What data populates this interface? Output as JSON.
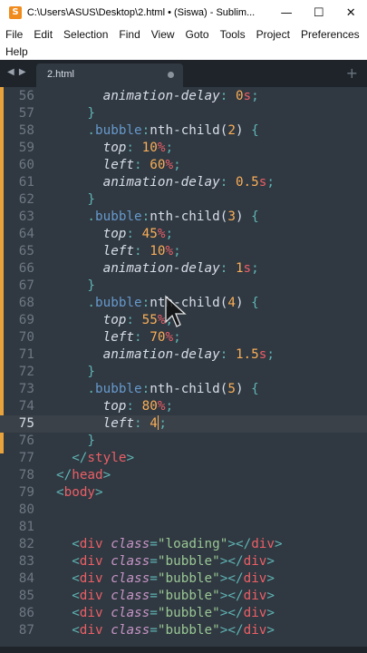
{
  "window": {
    "title": "C:\\Users\\ASUS\\Desktop\\2.html • (Siswa) - Sublim...",
    "minimize_glyph": "—",
    "maximize_glyph": "☐",
    "close_glyph": "✕"
  },
  "menu": [
    "File",
    "Edit",
    "Selection",
    "Find",
    "View",
    "Goto",
    "Tools",
    "Project",
    "Preferences",
    "Help"
  ],
  "tab": {
    "label": "2.html",
    "new_tab_glyph": "+"
  },
  "colors": {
    "background": "#303841",
    "keyword": "#c695c6",
    "selector": "#6699cc",
    "property": "#d8dee9",
    "number": "#f9ae58",
    "unit": "#ec5f66",
    "tag": "#ec5f66",
    "attribute": "#c695c6",
    "string": "#99c794",
    "punctuation": "#5fb4b4",
    "line_number": "#6d7883",
    "modified_bar": "#e8a33d"
  },
  "code_lines": [
    {
      "n": "56",
      "i": 3,
      "t": [
        [
          "p",
          "animation-delay"
        ],
        [
          "pn",
          ":"
        ],
        [
          "x",
          " "
        ],
        [
          "num",
          "0"
        ],
        [
          "u",
          "s"
        ],
        [
          "pn",
          ";"
        ]
      ]
    },
    {
      "n": "57",
      "i": 2,
      "t": [
        [
          "pn",
          "}"
        ]
      ]
    },
    {
      "n": "58",
      "i": 2,
      "t": [
        [
          "pn",
          "."
        ],
        [
          "sel",
          "bubble"
        ],
        [
          "pn",
          ":"
        ],
        [
          "x",
          "nth-child("
        ],
        [
          "num",
          "2"
        ],
        [
          "x",
          ") "
        ],
        [
          "pn",
          "{"
        ]
      ]
    },
    {
      "n": "59",
      "i": 3,
      "t": [
        [
          "p",
          "top"
        ],
        [
          "pn",
          ":"
        ],
        [
          "x",
          " "
        ],
        [
          "num",
          "10"
        ],
        [
          "u",
          "%"
        ],
        [
          "pn",
          ";"
        ]
      ]
    },
    {
      "n": "60",
      "i": 3,
      "t": [
        [
          "p",
          "left"
        ],
        [
          "pn",
          ":"
        ],
        [
          "x",
          " "
        ],
        [
          "num",
          "60"
        ],
        [
          "u",
          "%"
        ],
        [
          "pn",
          ";"
        ]
      ]
    },
    {
      "n": "61",
      "i": 3,
      "t": [
        [
          "p",
          "animation-delay"
        ],
        [
          "pn",
          ":"
        ],
        [
          "x",
          " "
        ],
        [
          "num",
          "0.5"
        ],
        [
          "u",
          "s"
        ],
        [
          "pn",
          ";"
        ]
      ]
    },
    {
      "n": "62",
      "i": 2,
      "t": [
        [
          "pn",
          "}"
        ]
      ]
    },
    {
      "n": "63",
      "i": 2,
      "t": [
        [
          "pn",
          "."
        ],
        [
          "sel",
          "bubble"
        ],
        [
          "pn",
          ":"
        ],
        [
          "x",
          "nth-child("
        ],
        [
          "num",
          "3"
        ],
        [
          "x",
          ") "
        ],
        [
          "pn",
          "{"
        ]
      ]
    },
    {
      "n": "64",
      "i": 3,
      "t": [
        [
          "p",
          "top"
        ],
        [
          "pn",
          ":"
        ],
        [
          "x",
          " "
        ],
        [
          "num",
          "45"
        ],
        [
          "u",
          "%"
        ],
        [
          "pn",
          ";"
        ]
      ]
    },
    {
      "n": "65",
      "i": 3,
      "t": [
        [
          "p",
          "left"
        ],
        [
          "pn",
          ":"
        ],
        [
          "x",
          " "
        ],
        [
          "num",
          "10"
        ],
        [
          "u",
          "%"
        ],
        [
          "pn",
          ";"
        ]
      ]
    },
    {
      "n": "66",
      "i": 3,
      "t": [
        [
          "p",
          "animation-delay"
        ],
        [
          "pn",
          ":"
        ],
        [
          "x",
          " "
        ],
        [
          "num",
          "1"
        ],
        [
          "u",
          "s"
        ],
        [
          "pn",
          ";"
        ]
      ]
    },
    {
      "n": "67",
      "i": 2,
      "t": [
        [
          "pn",
          "}"
        ]
      ]
    },
    {
      "n": "68",
      "i": 2,
      "t": [
        [
          "pn",
          "."
        ],
        [
          "sel",
          "bubble"
        ],
        [
          "pn",
          ":"
        ],
        [
          "x",
          "nth-child("
        ],
        [
          "num",
          "4"
        ],
        [
          "x",
          ") "
        ],
        [
          "pn",
          "{"
        ]
      ]
    },
    {
      "n": "69",
      "i": 3,
      "t": [
        [
          "p",
          "top"
        ],
        [
          "pn",
          ":"
        ],
        [
          "x",
          " "
        ],
        [
          "num",
          "55"
        ],
        [
          "u",
          "%"
        ],
        [
          "pn",
          ";"
        ]
      ]
    },
    {
      "n": "70",
      "i": 3,
      "t": [
        [
          "p",
          "left"
        ],
        [
          "pn",
          ":"
        ],
        [
          "x",
          " "
        ],
        [
          "num",
          "70"
        ],
        [
          "u",
          "%"
        ],
        [
          "pn",
          ";"
        ]
      ]
    },
    {
      "n": "71",
      "i": 3,
      "t": [
        [
          "p",
          "animation-delay"
        ],
        [
          "pn",
          ":"
        ],
        [
          "x",
          " "
        ],
        [
          "num",
          "1.5"
        ],
        [
          "u",
          "s"
        ],
        [
          "pn",
          ";"
        ]
      ]
    },
    {
      "n": "72",
      "i": 2,
      "t": [
        [
          "pn",
          "}"
        ]
      ]
    },
    {
      "n": "73",
      "i": 2,
      "t": [
        [
          "pn",
          "."
        ],
        [
          "sel",
          "bubble"
        ],
        [
          "pn",
          ":"
        ],
        [
          "x",
          "nth-child("
        ],
        [
          "num",
          "5"
        ],
        [
          "x",
          ") "
        ],
        [
          "pn",
          "{"
        ]
      ]
    },
    {
      "n": "74",
      "i": 3,
      "t": [
        [
          "p",
          "top"
        ],
        [
          "pn",
          ":"
        ],
        [
          "x",
          " "
        ],
        [
          "num",
          "80"
        ],
        [
          "u",
          "%"
        ],
        [
          "pn",
          ";"
        ]
      ]
    },
    {
      "n": "75",
      "i": 3,
      "current": true,
      "t": [
        [
          "p",
          "left"
        ],
        [
          "pn",
          ":"
        ],
        [
          "x",
          " "
        ],
        [
          "num",
          "4"
        ],
        [
          "caret",
          ""
        ],
        [
          "pn",
          ";"
        ]
      ]
    },
    {
      "n": "76",
      "i": 2,
      "t": [
        [
          "pn",
          "}"
        ]
      ]
    },
    {
      "n": "77",
      "i": 1,
      "t": [
        [
          "pn",
          "</"
        ],
        [
          "tag",
          "style"
        ],
        [
          "pn",
          ">"
        ]
      ]
    },
    {
      "n": "78",
      "i": 0,
      "t": [
        [
          "pn",
          "</"
        ],
        [
          "tag",
          "head"
        ],
        [
          "pn",
          ">"
        ]
      ]
    },
    {
      "n": "79",
      "i": 0,
      "t": [
        [
          "pn",
          "<"
        ],
        [
          "tag",
          "body"
        ],
        [
          "pn",
          ">"
        ]
      ]
    },
    {
      "n": "80",
      "i": 0,
      "t": []
    },
    {
      "n": "81",
      "i": 0,
      "t": []
    },
    {
      "n": "82",
      "i": 1,
      "t": [
        [
          "pn",
          "<"
        ],
        [
          "tag",
          "div"
        ],
        [
          "x",
          " "
        ],
        [
          "attr",
          "class"
        ],
        [
          "pn",
          "="
        ],
        [
          "str",
          "\"loading\""
        ],
        [
          "pn",
          "></"
        ],
        [
          "tag",
          "div"
        ],
        [
          "pn",
          ">"
        ]
      ]
    },
    {
      "n": "83",
      "i": 1,
      "t": [
        [
          "pn",
          "<"
        ],
        [
          "tag",
          "div"
        ],
        [
          "x",
          " "
        ],
        [
          "attr",
          "class"
        ],
        [
          "pn",
          "="
        ],
        [
          "str",
          "\"bubble\""
        ],
        [
          "pn",
          "></"
        ],
        [
          "tag",
          "div"
        ],
        [
          "pn",
          ">"
        ]
      ]
    },
    {
      "n": "84",
      "i": 1,
      "t": [
        [
          "pn",
          "<"
        ],
        [
          "tag",
          "div"
        ],
        [
          "x",
          " "
        ],
        [
          "attr",
          "class"
        ],
        [
          "pn",
          "="
        ],
        [
          "str",
          "\"bubble\""
        ],
        [
          "pn",
          "></"
        ],
        [
          "tag",
          "div"
        ],
        [
          "pn",
          ">"
        ]
      ]
    },
    {
      "n": "85",
      "i": 1,
      "t": [
        [
          "pn",
          "<"
        ],
        [
          "tag",
          "div"
        ],
        [
          "x",
          " "
        ],
        [
          "attr",
          "class"
        ],
        [
          "pn",
          "="
        ],
        [
          "str",
          "\"bubble\""
        ],
        [
          "pn",
          "></"
        ],
        [
          "tag",
          "div"
        ],
        [
          "pn",
          ">"
        ]
      ]
    },
    {
      "n": "86",
      "i": 1,
      "t": [
        [
          "pn",
          "<"
        ],
        [
          "tag",
          "div"
        ],
        [
          "x",
          " "
        ],
        [
          "attr",
          "class"
        ],
        [
          "pn",
          "="
        ],
        [
          "str",
          "\"bubble\""
        ],
        [
          "pn",
          "></"
        ],
        [
          "tag",
          "div"
        ],
        [
          "pn",
          ">"
        ]
      ]
    },
    {
      "n": "87",
      "i": 1,
      "t": [
        [
          "pn",
          "<"
        ],
        [
          "tag",
          "div"
        ],
        [
          "x",
          " "
        ],
        [
          "attr",
          "class"
        ],
        [
          "pn",
          "="
        ],
        [
          "str",
          "\"bubble\""
        ],
        [
          "pn",
          "></"
        ],
        [
          "tag",
          "div"
        ],
        [
          "pn",
          ">"
        ]
      ]
    }
  ]
}
